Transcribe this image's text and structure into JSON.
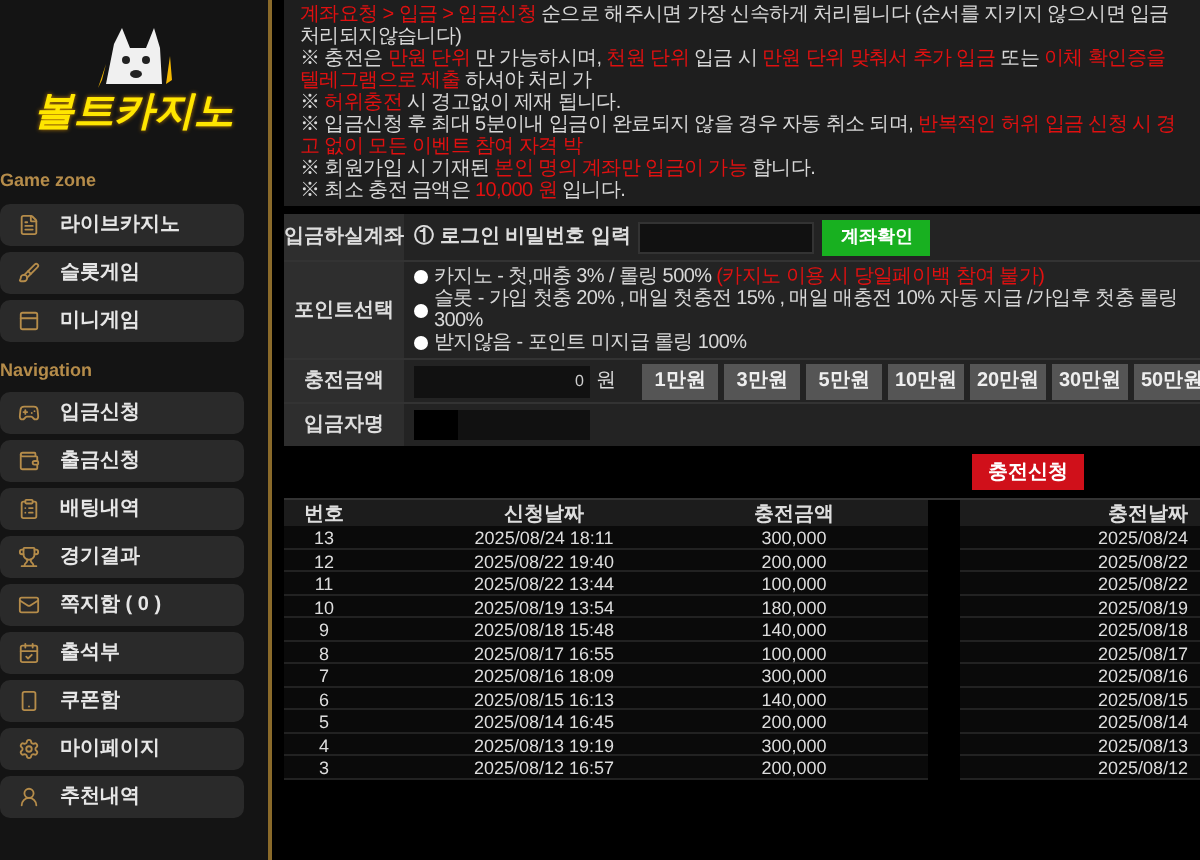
{
  "logo": {
    "text": "볼트카지노"
  },
  "sidebar": {
    "sections": [
      {
        "title": "Game zone",
        "items": [
          {
            "label": "라이브카지노"
          },
          {
            "label": "슬롯게임"
          },
          {
            "label": "미니게임"
          }
        ]
      },
      {
        "title": "Navigation",
        "items": [
          {
            "label": "입금신청"
          },
          {
            "label": "출금신청"
          },
          {
            "label": "배팅내역"
          },
          {
            "label": "경기결과"
          },
          {
            "label": "쪽지함 ( 0 )"
          },
          {
            "label": "출석부"
          },
          {
            "label": "쿠폰함"
          },
          {
            "label": "마이페이지"
          },
          {
            "label": "추천내역"
          }
        ]
      }
    ]
  },
  "notices": [
    [
      {
        "text": "계좌요청 > 입금 > 입금신청",
        "red": true
      },
      {
        "text": " 순으로 해주시면 가장 신속하게 처리됩니다 (순서를 지키지 않으시면 입금처리되지않습니다)",
        "red": false
      }
    ],
    [
      {
        "text": "※ 충전은 ",
        "red": false
      },
      {
        "text": "만원 단위",
        "red": true
      },
      {
        "text": " 만 가능하시며, ",
        "red": false
      },
      {
        "text": "천원 단위",
        "red": true
      },
      {
        "text": " 입금 시 ",
        "red": false
      },
      {
        "text": "만원 단위 맞춰서 추가 입금",
        "red": true
      },
      {
        "text": " 또는 ",
        "red": false
      },
      {
        "text": "이체 확인증을 텔레그램으로 제출",
        "red": true
      },
      {
        "text": " 하셔야 처리 가",
        "red": false
      }
    ],
    [
      {
        "text": "※ ",
        "red": false
      },
      {
        "text": "허위충전",
        "red": true
      },
      {
        "text": " 시 경고없이 제재 됩니다.",
        "red": false
      }
    ],
    [
      {
        "text": "※ 입금신청 후 최대 5분이내 입금이 완료되지 않을 경우 자동 취소 되며, ",
        "red": false
      },
      {
        "text": "반복적인 허위 입금 신청 시 경고 없이 모든 이벤트 참여 자격 박",
        "red": true
      }
    ],
    [
      {
        "text": "※ 회원가입 시 기재된 ",
        "red": false
      },
      {
        "text": "본인 명의 계좌만 입금이 가능",
        "red": true
      },
      {
        "text": " 합니다.",
        "red": false
      }
    ],
    [
      {
        "text": "※ 최소 충전 금액은 ",
        "red": false
      },
      {
        "text": "10,000 원",
        "red": true
      },
      {
        "text": " 입니다.",
        "red": false
      }
    ]
  ],
  "form": {
    "account": {
      "label": "입금하실계좌",
      "prompt": "① 로그인 비밀번호 입력",
      "button": "계좌확인"
    },
    "points": {
      "label": "포인트선택",
      "options": [
        {
          "parts": [
            {
              "text": "카지노 - 첫,매충 3% / 롤링 500% ",
              "red": false
            },
            {
              "text": "(카지노 이용 시 당일페이백 참여 불가)",
              "red": true
            }
          ],
          "selected": false
        },
        {
          "parts": [
            {
              "text": "슬롯 - 가입 첫충 20% , 매일 첫충전 15% , 매일 매충전 10% 자동 지급 /가입후 첫충 롤링 300%",
              "red": false
            }
          ],
          "selected": false
        },
        {
          "parts": [
            {
              "text": "받지않음 - 포인트 미지급 롤링 100%",
              "red": false
            }
          ],
          "selected": false
        }
      ]
    },
    "amount": {
      "label": "충전금액",
      "value": "0",
      "unit": "원",
      "presets": [
        "1만원",
        "3만원",
        "5만원",
        "10만원",
        "20만원",
        "30만원",
        "50만원"
      ]
    },
    "depositor": {
      "label": "입금자명"
    },
    "submit": "충전신청"
  },
  "table": {
    "columns": [
      "번호",
      "신청날짜",
      "충전금액",
      null,
      "충전날짜"
    ],
    "rows": [
      [
        "13",
        "2025/08/24 18:11",
        "300,000",
        "2025/08/24"
      ],
      [
        "12",
        "2025/08/22 19:40",
        "200,000",
        "2025/08/22"
      ],
      [
        "11",
        "2025/08/22 13:44",
        "100,000",
        "2025/08/22"
      ],
      [
        "10",
        "2025/08/19 13:54",
        "180,000",
        "2025/08/19"
      ],
      [
        "9",
        "2025/08/18 15:48",
        "140,000",
        "2025/08/18"
      ],
      [
        "8",
        "2025/08/17 16:55",
        "100,000",
        "2025/08/17"
      ],
      [
        "7",
        "2025/08/16 18:09",
        "300,000",
        "2025/08/16"
      ],
      [
        "6",
        "2025/08/15 16:13",
        "140,000",
        "2025/08/15"
      ],
      [
        "5",
        "2025/08/14 16:45",
        "200,000",
        "2025/08/14"
      ],
      [
        "4",
        "2025/08/13 19:19",
        "300,000",
        "2025/08/13"
      ],
      [
        "3",
        "2025/08/12 16:57",
        "200,000",
        "2025/08/12"
      ]
    ]
  }
}
